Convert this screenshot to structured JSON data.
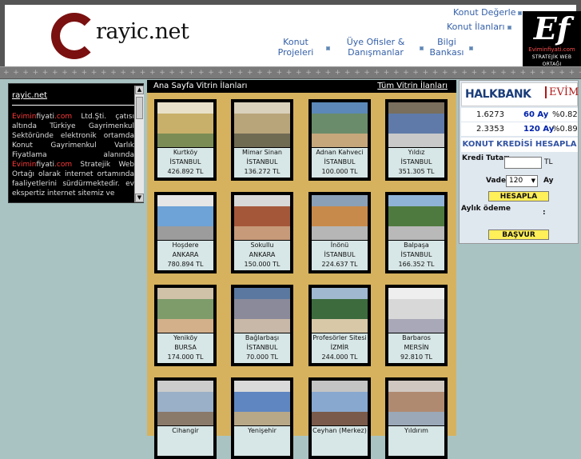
{
  "brand": {
    "logo_text": "rayic.net"
  },
  "top_links": {
    "konut_degerle": "Konut Değerle",
    "konut_ilanlari": "Konut İlanları"
  },
  "nav": {
    "projeler": [
      "Konut",
      "Projeleri"
    ],
    "ofisler": [
      "Üye Ofisler &",
      "Danışmanlar"
    ],
    "bilgi": [
      "Bilgi",
      "Bankası"
    ]
  },
  "ef_logo": {
    "letters": "Ef",
    "site": "Eviminfiyati.com",
    "tag": "STRATEJİK WEB ORTAĞI"
  },
  "left_box": {
    "title": "rayic.net",
    "brand_red": "Evimin",
    "brand_plain": "fiyati",
    "brand_dot": ".com",
    "paragraph1": " Ltd.Şti. çatısı altında Türkiye Gayrimenkul Sektöründe elektronik ortamda Konut Gayrimenkul Varlık Fiyatlama alanında ",
    "paragraph2": " Stratejik Web Ortağı olarak internet ortamında faaliyetlerini sürdürmektedir. ev ekspertiz internet sitemiz ve"
  },
  "vitrin": {
    "header_title": "Ana Sayfa Vitrin İlanları",
    "all_link": "Tüm Vitrin İlanları",
    "listings": [
      {
        "name": "Kurtköy",
        "city": "İSTANBUL",
        "price": "426.892 TL"
      },
      {
        "name": "Mimar Sinan",
        "city": "İSTANBUL",
        "price": "136.272 TL"
      },
      {
        "name": "Adnan Kahveci",
        "city": "İSTANBUL",
        "price": "100.000 TL"
      },
      {
        "name": "Yıldız",
        "city": "İSTANBUL",
        "price": "351.305 TL"
      },
      {
        "name": "Hoşdere",
        "city": "ANKARA",
        "price": "780.894 TL"
      },
      {
        "name": "Sokullu",
        "city": "ANKARA",
        "price": "150.000 TL"
      },
      {
        "name": "İnönü",
        "city": "İSTANBUL",
        "price": "224.637 TL"
      },
      {
        "name": "Balpaşa",
        "city": "İSTANBUL",
        "price": "166.352 TL"
      },
      {
        "name": "Yeniköy",
        "city": "BURSA",
        "price": "174.000 TL"
      },
      {
        "name": "Bağlarbaşı",
        "city": "İSTANBUL",
        "price": "70.000 TL"
      },
      {
        "name": "Profesörler Sitesi",
        "city": "İZMİR",
        "price": "244.000 TL"
      },
      {
        "name": "Barbaros",
        "city": "MERSİN",
        "price": "92.810 TL"
      },
      {
        "name": "Cihangir",
        "city": "",
        "price": ""
      },
      {
        "name": "Yenişehir",
        "city": "",
        "price": ""
      },
      {
        "name": "Ceyhan (Merkez)",
        "city": "",
        "price": ""
      },
      {
        "name": "Yıldırım",
        "city": "",
        "price": ""
      }
    ]
  },
  "bank": {
    "name": "HALKBANK",
    "product": "EVİM",
    "rates": [
      {
        "value": "1.6273",
        "term": "60 Ay",
        "pct": "%0.82"
      },
      {
        "value": "2.3353",
        "term": "120 Ay",
        "pct": "%0.89"
      }
    ]
  },
  "calculator": {
    "title": "KONUT KREDİSİ HESAPLA",
    "amount_label": "Kredi Tutarı",
    "amount_unit": "TL",
    "term_label": "Vade",
    "term_value": "120",
    "term_unit": "Ay",
    "calc_button": "HESAPLA",
    "monthly_label": "Aylık ödeme",
    "monthly_colon": ":",
    "apply_button": "BAŞVUR"
  },
  "colors": {
    "accent_blue": "#3560a8",
    "brand_red": "#7a1010",
    "panel_gold": "#d6b25e",
    "background": "#a9c3c3"
  }
}
